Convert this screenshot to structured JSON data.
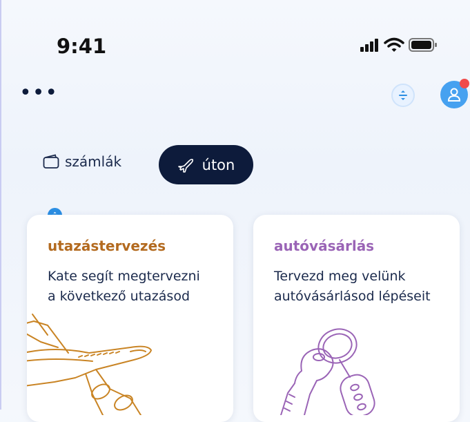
{
  "status_bar": {
    "time": "9:41"
  },
  "header": {
    "menu_label": "•••"
  },
  "tabs": [
    {
      "label": "számlák",
      "active": false
    },
    {
      "label": "úton",
      "active": true
    }
  ],
  "cards": [
    {
      "title": "utazástervezés",
      "desc_line1": "Kate segít megtervezni",
      "desc_line2": "a következő utazásod",
      "art": "airplane-illustration"
    },
    {
      "title": "autóvásárlás",
      "desc_line1": "Tervezd meg velünk",
      "desc_line2": "autóvásárlásod lépéseit",
      "art": "car-keys-illustration"
    }
  ],
  "colors": {
    "primary_dark": "#0d1b3b",
    "accent_blue": "#2b8ee3",
    "travel_orange": "#b36a1f",
    "car_purple": "#9a64b6",
    "notification_red": "#f04a4a"
  }
}
